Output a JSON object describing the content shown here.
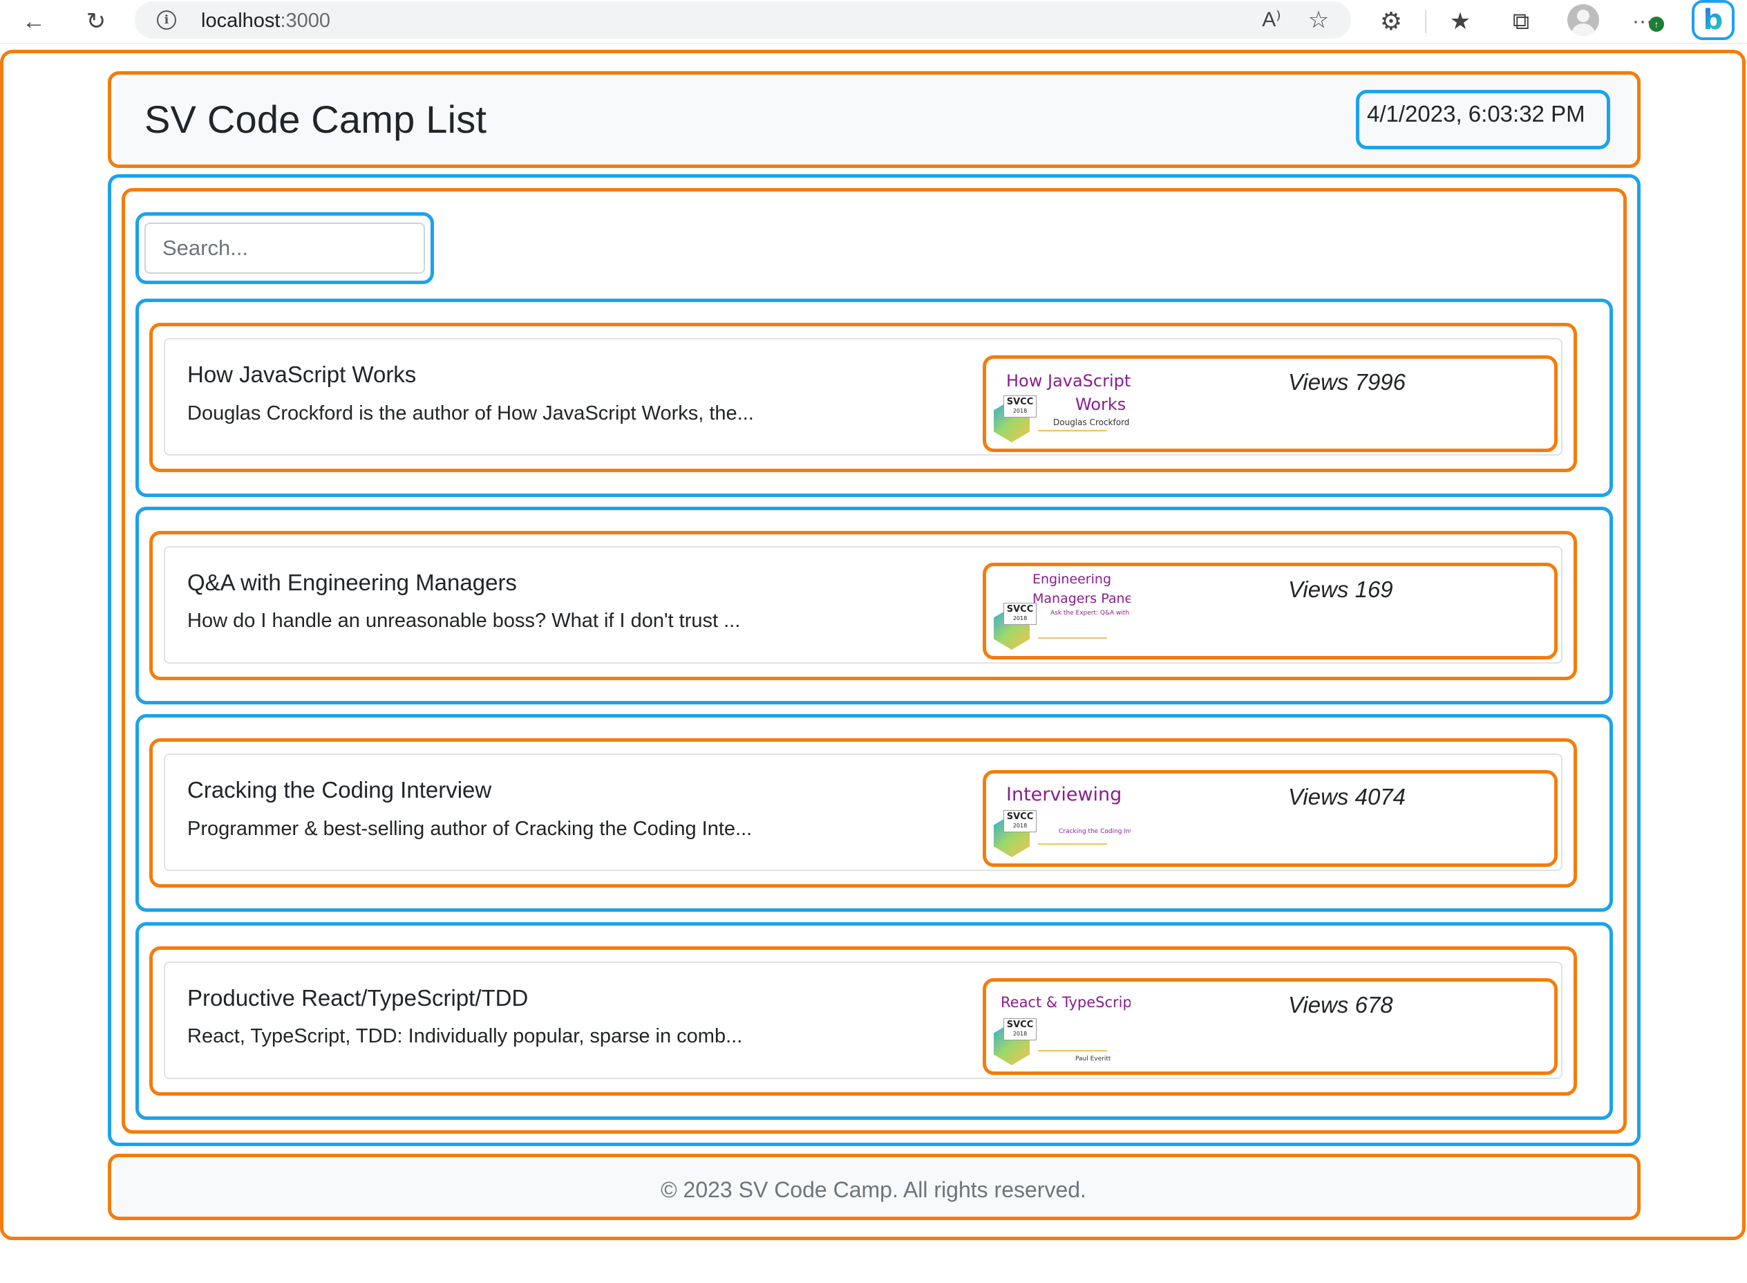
{
  "browser": {
    "url_host": "localhost",
    "url_port": ":3000",
    "read_aloud_glyph": "A⁾",
    "menu_glyph": "···",
    "badge_glyph": "↑",
    "bing_glyph": "b",
    "icons": [
      "back-arrow-icon",
      "refresh-icon",
      "info-icon",
      "read-aloud-icon",
      "add-favorite-icon",
      "extensions-icon",
      "favorites-icon",
      "collections-icon",
      "profile-icon",
      "more-menu-icon",
      "bing-icon"
    ]
  },
  "header": {
    "title": "SV Code Camp List",
    "datetime": "4/1/2023, 6:03:32 PM"
  },
  "search": {
    "placeholder": "Search..."
  },
  "sessions": [
    {
      "title": "How JavaScript Works",
      "description": "Douglas Crockford is the author of How JavaScript Works, the...",
      "views": "Views 7996",
      "thumb_title_1": "How JavaScript",
      "thumb_title_2": "Works",
      "thumb_speakers": "Douglas Crockford"
    },
    {
      "title": "Q&A with Engineering Managers",
      "description": "How do I handle an unreasonable boss? What if I don't trust ...",
      "views": "Views 169",
      "thumb_title_1": "Engineering",
      "thumb_title_2": "Managers Panel",
      "thumb_speakers": "Ask the Expert: Q&A with Engineering Managers"
    },
    {
      "title": "Cracking the Coding Interview",
      "description": "Programmer & best-selling author of Cracking the Coding Inte...",
      "views": "Views 4074",
      "thumb_title_1": "Interviewing",
      "thumb_title_2": "",
      "thumb_speakers": "Cracking the Coding Interview"
    },
    {
      "title": "Productive React/TypeScript/TDD",
      "description": "React, TypeScript, TDD: Individually popular, sparse in comb...",
      "views": "Views 678",
      "thumb_title_1": "React & TypeScript",
      "thumb_title_2": "",
      "thumb_speakers": "Paul Everitt"
    }
  ],
  "thumb_logo": "SVCC",
  "thumb_logo_year": "2018",
  "footer": {
    "text": "© 2023 SV Code Camp. All rights reserved."
  },
  "colors": {
    "highlight_orange": "#f57c0a",
    "highlight_blue": "#1ba3ec",
    "thumb_purple": "#8a1d8f"
  }
}
